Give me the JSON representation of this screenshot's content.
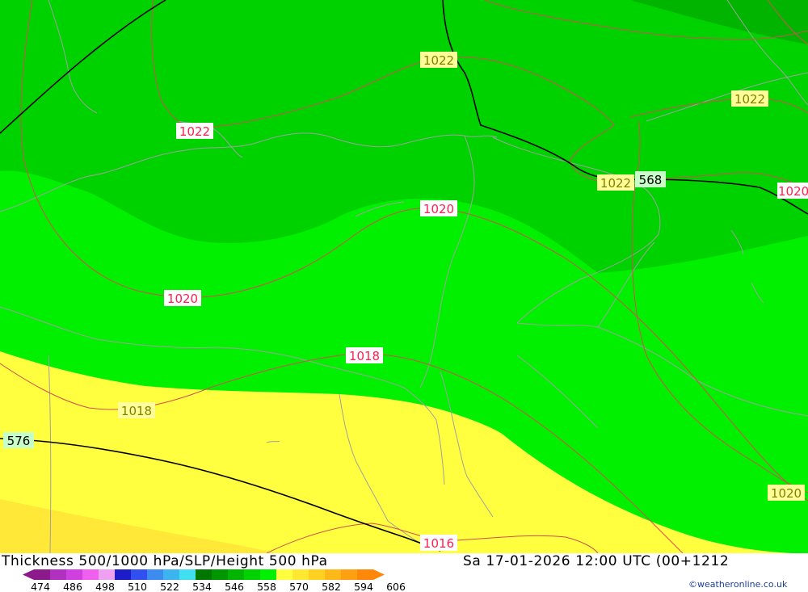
{
  "title_left": "Thickness 500/1000 hPa/SLP/Height 500 hPa",
  "title_right": "Sa 17-01-2026 12:00 UTC (00+1212",
  "credit": "©weatheronline.co.uk",
  "legend": {
    "ticks": [
      "474",
      "486",
      "498",
      "510",
      "522",
      "534",
      "546",
      "558",
      "570",
      "582",
      "594",
      "606"
    ],
    "colors": [
      "#8c1a8c",
      "#b030c0",
      "#d040e0",
      "#f060f0",
      "#f0a0f0",
      "#1c1cc8",
      "#3050f0",
      "#3c8cf0",
      "#3cb4f0",
      "#40e0f0",
      "#007800",
      "#009600",
      "#00b400",
      "#00d200",
      "#00f000",
      "#ffff40",
      "#ffe830",
      "#ffd020",
      "#ffb818",
      "#ffa010",
      "#ff8808"
    ]
  },
  "map": {
    "fill_colors": {
      "dark_green": "#00b400",
      "mid_green": "#00d200",
      "bright_green": "#00f000",
      "yellow": "#ffff40",
      "gold": "#ffe838"
    },
    "isobar_color": "#d05050",
    "height_contour_color": "#000000",
    "coast_color": "#a0a0a0",
    "isobar_labels": [
      {
        "text": "1022",
        "style": "yellow"
      },
      {
        "text": "1022",
        "style": "red"
      },
      {
        "text": "1022",
        "style": "yellow"
      },
      {
        "text": "1022",
        "style": "yellow"
      },
      {
        "text": "1020",
        "style": "red"
      },
      {
        "text": "1020",
        "style": "red"
      },
      {
        "text": "1020",
        "style": "red"
      },
      {
        "text": "1018",
        "style": "red"
      },
      {
        "text": "1018",
        "style": "yellow"
      },
      {
        "text": "1020",
        "style": "yellow"
      },
      {
        "text": "1016",
        "style": "red"
      }
    ],
    "height_labels": [
      {
        "text": "568"
      },
      {
        "text": "576"
      }
    ]
  }
}
